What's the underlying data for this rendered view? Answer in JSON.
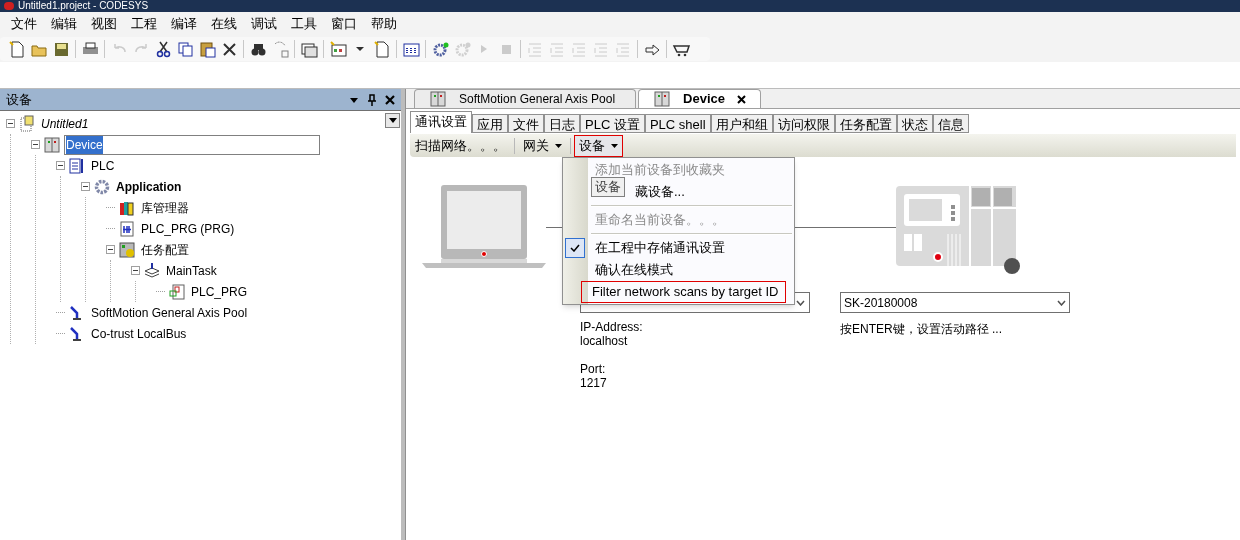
{
  "window": {
    "title": "Untitled1.project - CODESYS"
  },
  "menu_bar": [
    "文件",
    "编辑",
    "视图",
    "工程",
    "编译",
    "在线",
    "调试",
    "工具",
    "窗口",
    "帮助"
  ],
  "toolbar": [
    {
      "kind": "new",
      "disabled": false
    },
    {
      "kind": "open",
      "disabled": false
    },
    {
      "kind": "save",
      "disabled": false
    },
    {
      "kind": "separator"
    },
    {
      "kind": "print",
      "disabled": false
    },
    {
      "kind": "separator"
    },
    {
      "kind": "undo",
      "disabled": true
    },
    {
      "kind": "redo",
      "disabled": true
    },
    {
      "kind": "cut",
      "disabled": false
    },
    {
      "kind": "copy",
      "disabled": false
    },
    {
      "kind": "paste",
      "disabled": false
    },
    {
      "kind": "delete",
      "disabled": false
    },
    {
      "kind": "separator"
    },
    {
      "kind": "find",
      "disabled": false
    },
    {
      "kind": "replace",
      "disabled": false
    },
    {
      "kind": "separator"
    },
    {
      "kind": "window",
      "disabled": false
    },
    {
      "kind": "separator"
    },
    {
      "kind": "add",
      "disabled": false
    },
    {
      "kind": "dropdown",
      "disabled": false
    },
    {
      "kind": "export",
      "disabled": false
    },
    {
      "kind": "separator"
    },
    {
      "kind": "build",
      "disabled": false
    },
    {
      "kind": "separator"
    },
    {
      "kind": "login",
      "disabled": false
    },
    {
      "kind": "logout",
      "disabled": true
    },
    {
      "kind": "run",
      "disabled": true
    },
    {
      "kind": "stop",
      "disabled": true
    },
    {
      "kind": "separator"
    },
    {
      "kind": "step",
      "disabled": true
    },
    {
      "kind": "step",
      "disabled": true
    },
    {
      "kind": "step",
      "disabled": true
    },
    {
      "kind": "step",
      "disabled": true
    },
    {
      "kind": "step",
      "disabled": true
    },
    {
      "kind": "separator"
    },
    {
      "kind": "next",
      "disabled": false
    },
    {
      "kind": "separator"
    },
    {
      "kind": "cart",
      "disabled": false
    }
  ],
  "device_panel": {
    "title": "设备",
    "tree": [
      {
        "label": "Untitled1",
        "kind": "project",
        "expanded": true,
        "selected": false,
        "children": [
          {
            "label": "Device",
            "kind": "device",
            "expanded": true,
            "selected": true,
            "children": [
              {
                "label": "PLC",
                "kind": "plc",
                "expanded": true,
                "selected": false,
                "children": [
                  {
                    "label": "Application",
                    "kind": "application",
                    "expanded": true,
                    "selected": false,
                    "children": [
                      {
                        "label": "库管理器",
                        "kind": "library",
                        "selected": false
                      },
                      {
                        "label": "PLC_PRG (PRG)",
                        "kind": "pou",
                        "selected": false
                      },
                      {
                        "label": "任务配置",
                        "kind": "tasks",
                        "expanded": true,
                        "selected": false,
                        "children": [
                          {
                            "label": "MainTask",
                            "kind": "task",
                            "expanded": true,
                            "selected": false,
                            "children": [
                              {
                                "label": "PLC_PRG",
                                "kind": "program",
                                "selected": false
                              }
                            ]
                          }
                        ]
                      }
                    ]
                  }
                ]
              },
              {
                "label": "SoftMotion General Axis Pool",
                "kind": "axis",
                "selected": false
              },
              {
                "label": "Co-trust LocalBus",
                "kind": "axis",
                "selected": false
              }
            ]
          }
        ]
      }
    ]
  },
  "editor_tabs": [
    {
      "label": "SoftMotion General Axis Pool",
      "selected": false
    },
    {
      "label": "Device",
      "selected": true
    }
  ],
  "device_tabs": [
    {
      "label": "通讯设置",
      "selected": true
    },
    {
      "label": "应用",
      "selected": false
    },
    {
      "label": "文件",
      "selected": false
    },
    {
      "label": "日志",
      "selected": false
    },
    {
      "label": "PLC 设置",
      "selected": false
    },
    {
      "label": "PLC shell",
      "selected": false
    },
    {
      "label": "用户和组",
      "selected": false
    },
    {
      "label": "访问权限",
      "selected": false
    },
    {
      "label": "任务配置",
      "selected": false
    },
    {
      "label": "状态",
      "selected": false
    },
    {
      "label": "信息",
      "selected": false
    }
  ],
  "comm_toolbar": [
    {
      "label": "扫描网络。。。",
      "dropdown": false,
      "marked": false
    },
    {
      "label": "网关",
      "dropdown": true,
      "marked": false
    },
    {
      "label": "设备",
      "dropdown": true,
      "marked": true
    }
  ],
  "device_menu": [
    {
      "label": "添加当前设备到收藏夹",
      "disabled": true,
      "checked": false,
      "marked": false,
      "kind": "item"
    },
    {
      "label": "藏设备...",
      "disabled": false,
      "checked": false,
      "marked": false,
      "kind": "item"
    },
    {
      "kind": "separator"
    },
    {
      "label": "重命名当前设备。。。",
      "disabled": true,
      "checked": false,
      "marked": false,
      "kind": "item"
    },
    {
      "kind": "separator"
    },
    {
      "label": "在工程中存储通讯设置",
      "disabled": false,
      "checked": true,
      "marked": false,
      "kind": "item"
    },
    {
      "label": "确认在线模式",
      "disabled": false,
      "checked": false,
      "marked": false,
      "kind": "item"
    },
    {
      "label": "Filter network scans by target ID",
      "disabled": false,
      "checked": false,
      "marked": true,
      "kind": "item"
    }
  ],
  "tooltip": "设备",
  "gateway": {
    "details": [
      {
        "label": "IP-Address:",
        "value": "localhost"
      },
      {
        "label": "Port:",
        "value": "1217"
      }
    ]
  },
  "device": {
    "value": "SK-20180008",
    "hint": "按ENTER键，设置活动路径 ..."
  }
}
